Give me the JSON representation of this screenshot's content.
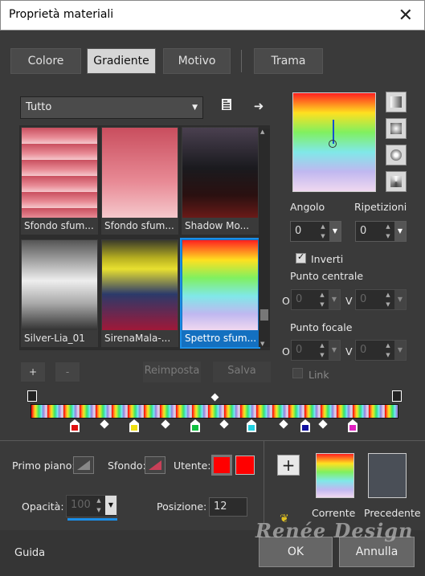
{
  "window": {
    "title": "Proprietà materiali"
  },
  "tabs": [
    {
      "label": "Colore"
    },
    {
      "label": "Gradiente"
    },
    {
      "label": "Motivo"
    },
    {
      "label": "Trama"
    }
  ],
  "category": {
    "value": "Tutto"
  },
  "gallery": [
    {
      "label": "Sfondo sfum..."
    },
    {
      "label": "Sfondo sfum..."
    },
    {
      "label": "Shadow Mo..."
    },
    {
      "label": "Silver-Lia_01"
    },
    {
      "label": "SirenaMala-..."
    },
    {
      "label": "Spettro sfum..."
    }
  ],
  "gallery_buttons": {
    "add": "+",
    "remove": "-",
    "reset": "Reimposta",
    "save": "Salva"
  },
  "angle": {
    "label": "Angolo",
    "value": "0"
  },
  "repeats": {
    "label": "Ripetizioni",
    "value": "0"
  },
  "invert": {
    "label": "Inverti",
    "checked": true
  },
  "center_point": {
    "label": "Punto centrale",
    "x_label": "O",
    "x": "0",
    "y_label": "V",
    "y": "0"
  },
  "focal_point": {
    "label": "Punto focale",
    "x_label": "O",
    "x": "0",
    "y_label": "V",
    "y": "0"
  },
  "link": {
    "label": "Link"
  },
  "foreground": {
    "label": "Primo piano:"
  },
  "background": {
    "label": "Sfondo:"
  },
  "user": {
    "label": "Utente:"
  },
  "opacity": {
    "label": "Opacità:",
    "value": "100"
  },
  "position": {
    "label": "Posizione:",
    "value": "12"
  },
  "current": {
    "label": "Corrente"
  },
  "previous": {
    "label": "Precedente"
  },
  "footer": {
    "help": "Guida",
    "ok": "OK",
    "cancel": "Annulla"
  },
  "watermark": "Renée Design",
  "colors": {
    "accent": "#1b8fe8",
    "stop_red": "#ff0000",
    "previous": "#4a4f57"
  }
}
